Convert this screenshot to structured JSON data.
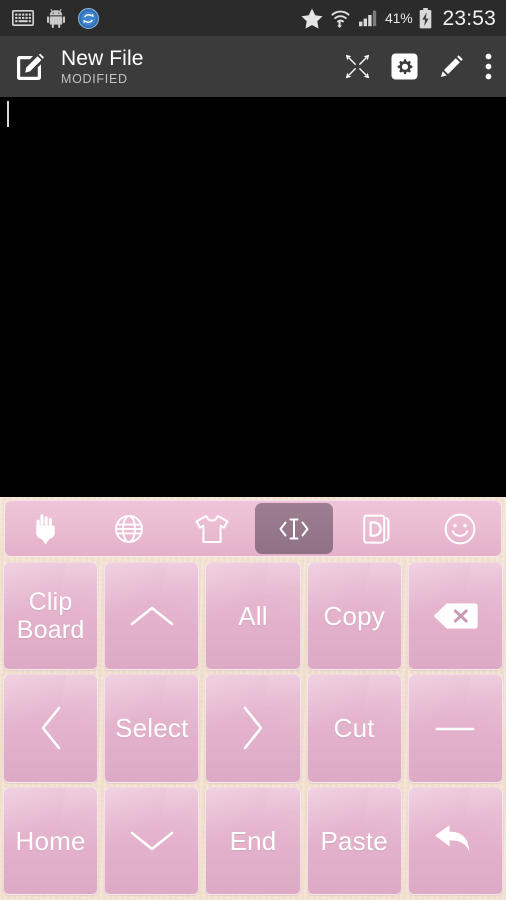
{
  "status_bar": {
    "background_color": "#2b2b2b",
    "left_icons": [
      {
        "name": "keyboard-icon",
        "label": "keyboard"
      },
      {
        "name": "android-robot-icon",
        "label": "android"
      },
      {
        "name": "sync-refresh-icon",
        "label": "sync",
        "color": "#3d7cc9"
      }
    ],
    "right_icons": [
      {
        "name": "star-icon",
        "label": "star"
      },
      {
        "name": "wifi-transfer-icon",
        "label": "wifi"
      },
      {
        "name": "cell-signal-icon",
        "label": "signal"
      }
    ],
    "battery_percent": "41%",
    "battery_state": "charging",
    "clock": "23:53"
  },
  "app_bar": {
    "background_color": "#3b3b3b",
    "icon": "edit-document-icon",
    "title": "New File",
    "subtitle": "MODIFIED",
    "actions": [
      {
        "name": "fullscreen-button",
        "icon": "expand-arrows-icon"
      },
      {
        "name": "settings-button",
        "icon": "gear-icon"
      },
      {
        "name": "edit-button",
        "icon": "pencil-icon"
      },
      {
        "name": "overflow-menu-button",
        "icon": "three-dots-vertical-icon"
      }
    ]
  },
  "editor": {
    "background_color": "#000000",
    "content": "",
    "caret_visible": true
  },
  "keyboard": {
    "background_color": "#f1ddc9",
    "key_color": "#e3b1cb",
    "key_text_color": "#ffffff",
    "selected_tab_color": "#947588",
    "toolbar": [
      {
        "name": "gesture-hand-icon",
        "label": "gesture",
        "selected": false
      },
      {
        "name": "globe-language-icon",
        "label": "language",
        "selected": false
      },
      {
        "name": "tshirt-theme-icon",
        "label": "theme",
        "selected": false
      },
      {
        "name": "text-cursor-arrows-icon",
        "label": "text-navigation",
        "selected": true
      },
      {
        "name": "dictionary-card-icon",
        "label": "dictionary",
        "selected": false
      },
      {
        "name": "smiley-emoji-icon",
        "label": "emoji",
        "selected": false
      }
    ],
    "rows": [
      [
        {
          "name": "clipboard-key",
          "type": "text",
          "label": "Clip\nBoard"
        },
        {
          "name": "arrow-up-key",
          "type": "icon",
          "icon": "chevron-up-icon",
          "label": ""
        },
        {
          "name": "select-all-key",
          "type": "text",
          "label": "All"
        },
        {
          "name": "copy-key",
          "type": "text",
          "label": "Copy"
        },
        {
          "name": "backspace-key",
          "type": "icon",
          "icon": "backspace-icon",
          "label": ""
        }
      ],
      [
        {
          "name": "arrow-left-key",
          "type": "icon",
          "icon": "chevron-left-icon",
          "label": ""
        },
        {
          "name": "select-key",
          "type": "text",
          "label": "Select"
        },
        {
          "name": "arrow-right-key",
          "type": "icon",
          "icon": "chevron-right-icon",
          "label": ""
        },
        {
          "name": "cut-key",
          "type": "text",
          "label": "Cut"
        },
        {
          "name": "space-key",
          "type": "icon",
          "icon": "underscore-space-icon",
          "label": ""
        }
      ],
      [
        {
          "name": "home-key",
          "type": "text",
          "label": "Home"
        },
        {
          "name": "arrow-down-key",
          "type": "icon",
          "icon": "chevron-down-icon",
          "label": ""
        },
        {
          "name": "end-key",
          "type": "text",
          "label": "End"
        },
        {
          "name": "paste-key",
          "type": "text",
          "label": "Paste"
        },
        {
          "name": "enter-return-key",
          "type": "icon",
          "icon": "return-arrow-icon",
          "label": ""
        }
      ]
    ]
  }
}
